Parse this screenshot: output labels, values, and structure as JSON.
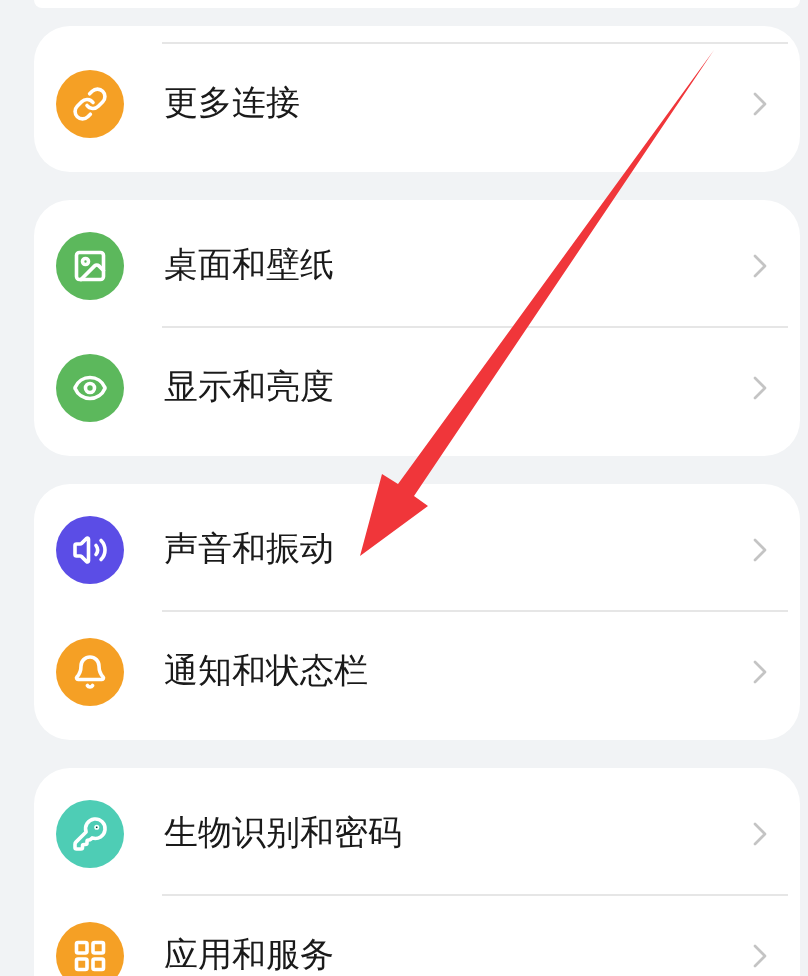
{
  "groups": [
    {
      "items": [
        {
          "label": "更多连接",
          "color": "#f5a025"
        }
      ]
    },
    {
      "items": [
        {
          "label": "桌面和壁纸",
          "color": "#5cb85c"
        },
        {
          "label": "显示和亮度",
          "color": "#5cb85c"
        }
      ]
    },
    {
      "items": [
        {
          "label": "声音和振动",
          "color": "#5b4de6"
        },
        {
          "label": "通知和状态栏",
          "color": "#f5a025"
        }
      ]
    },
    {
      "items": [
        {
          "label": "生物识别和密码",
          "color": "#4ecdb5"
        },
        {
          "label": "应用和服务",
          "color": "#f5a025"
        }
      ]
    }
  ]
}
